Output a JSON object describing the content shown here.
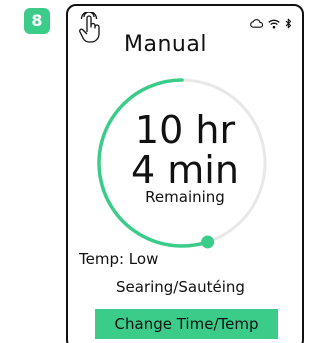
{
  "step": {
    "number": "8"
  },
  "header": {
    "title": "Manual"
  },
  "status_icons": [
    "cloud-icon",
    "wifi-icon",
    "bluetooth-icon"
  ],
  "timer": {
    "hours": "10 hr",
    "minutes": "4 min",
    "label": "Remaining",
    "progress_fraction": 0.55
  },
  "temp": {
    "label": "Temp: Low"
  },
  "mode": {
    "label": "Searing/Sautéing"
  },
  "actions": {
    "change_label": "Change Time/Temp"
  },
  "colors": {
    "accent": "#3ccc8a",
    "ring_track": "#e8e8e8",
    "text": "#111111"
  }
}
